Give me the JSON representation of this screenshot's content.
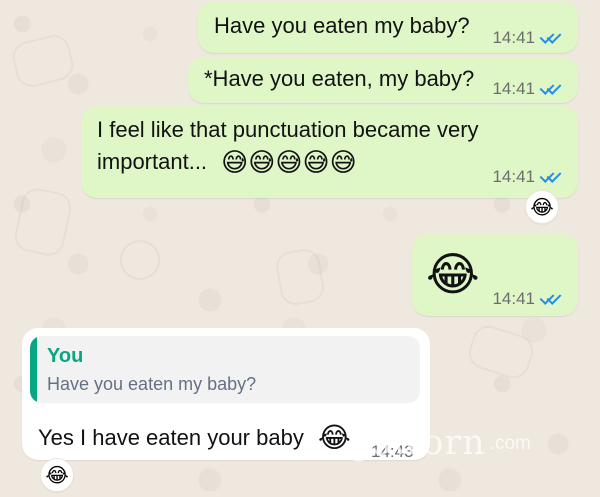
{
  "messages": [
    {
      "text": "Have you eaten my baby?",
      "time": "14:41"
    },
    {
      "text": "*Have you eaten, my baby?",
      "time": "14:41"
    },
    {
      "line1": "I feel like that punctuation became very",
      "line2": "important...",
      "emojis": "😅😅😅😅😅",
      "time": "14:41",
      "reaction": "😂"
    },
    {
      "emoji": "😂",
      "time": "14:41"
    },
    {
      "reply_author": "You",
      "reply_text": "Have you eaten my baby?",
      "text": "Yes I have eaten your baby",
      "emoji": "😂",
      "time": "14:43",
      "reaction": "😂"
    }
  ],
  "icons": {
    "read_receipt": "double-check-icon"
  },
  "watermark": {
    "main": "gsworn",
    "suffix": ".com"
  },
  "colors": {
    "outgoing_bubble": "#dff7c7",
    "incoming_bubble": "#ffffff",
    "reply_accent": "#06a884",
    "read_ticks": "#1f8ef1",
    "background": "#efe8df"
  }
}
